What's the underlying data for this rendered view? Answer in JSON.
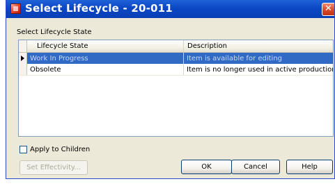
{
  "window": {
    "title": "Select Lifecycle - 20-011",
    "close_glyph": "✕"
  },
  "section": {
    "label": "Select Lifecycle State"
  },
  "grid": {
    "columns": [
      "Lifecycle State",
      "Description"
    ],
    "rows": [
      {
        "state": "Work In Progress",
        "description": "Item is available for editing",
        "selected": true
      },
      {
        "state": "Obsolete",
        "description": "Item is no longer used in active production",
        "selected": false
      }
    ]
  },
  "options": {
    "apply_to_children": {
      "label": "Apply to Children",
      "checked": false
    }
  },
  "buttons": {
    "set_effectivity": "Set Effectivity...",
    "ok": "OK",
    "cancel": "Cancel",
    "help": "Help"
  },
  "icons": {
    "app": "lifecycle-app-icon",
    "close": "close-icon",
    "row_indicator": "row-pointer-icon"
  },
  "colors": {
    "titlebar": "#0b47c4",
    "selection": "#316ac5",
    "dialog_bg": "#ece9d8"
  }
}
